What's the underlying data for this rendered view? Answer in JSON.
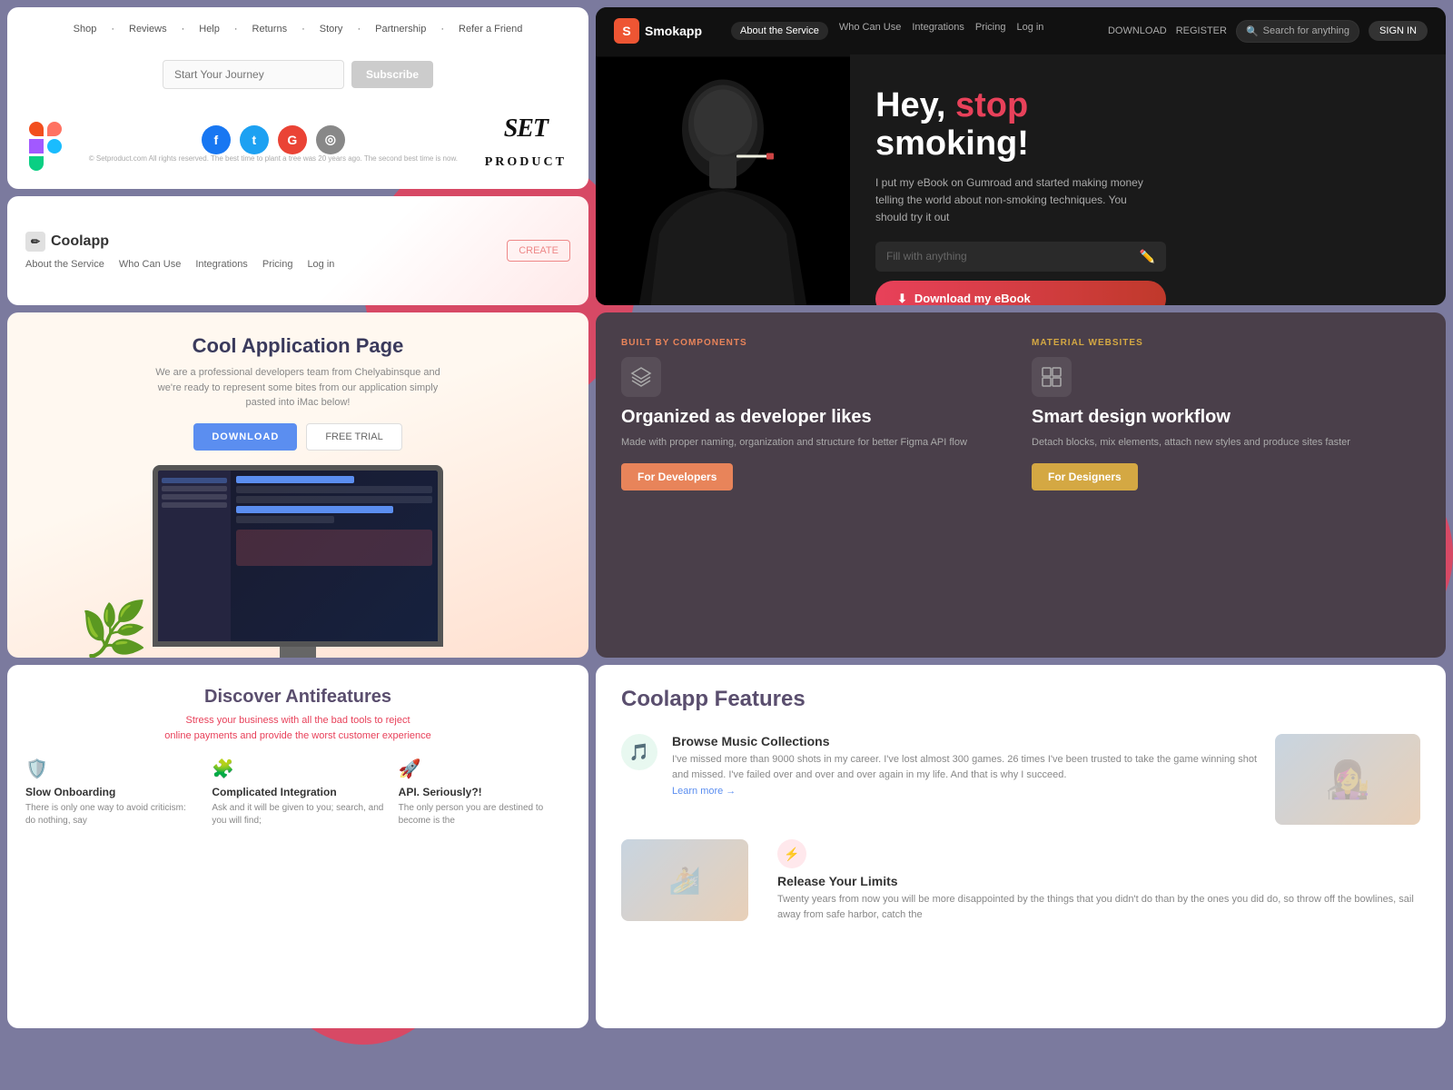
{
  "background": "#7b7a9e",
  "blobs": {
    "colors": [
      "#e8415a"
    ]
  },
  "card_setproduct": {
    "nav": [
      "Shop",
      "Reviews",
      "Help",
      "Returns",
      "Story",
      "Partnership",
      "Refer a Friend"
    ],
    "newsletter_placeholder": "Start Your Journey",
    "subscribe_label": "Subscribe",
    "social": [
      "f",
      "t",
      "g+",
      "ig"
    ],
    "logo_text": "SET",
    "logo_sub": "PRODUCT",
    "footer": "© Setproduct.com All rights reserved. The best time to plant a tree was 20 years ago. The second best time is now."
  },
  "card_smokapp": {
    "logo": "Smokapp",
    "logo_initial": "S",
    "nav_links": [
      "About the Service",
      "Who Can Use",
      "Integrations",
      "Pricing",
      "Log in"
    ],
    "nav_actions": [
      "DOWNLOAD",
      "REGISTER",
      "SIGN IN"
    ],
    "search_placeholder": "Search for anything",
    "heading_part1": "Hey, ",
    "heading_highlight": "stop",
    "heading_part2": " smoking!",
    "description": "I put my eBook on Gumroad and started making money telling the world about non-smoking techniques. You should try it out",
    "input_placeholder": "Fill with anything",
    "download_btn": "Download my eBook"
  },
  "card_coolapp_small": {
    "logo": "Coolapp",
    "nav_links": [
      "About the Service",
      "Who Can Use",
      "Integrations",
      "Pricing",
      "Log in"
    ],
    "create_btn": "CREATE"
  },
  "card_coolapp_main": {
    "title": "Cool Application Page",
    "subtitle": "We are a professional developers team from Chelyabinsque and we're ready to represent some bites from our application simply pasted into iMac below!",
    "download_btn": "DOWNLOAD",
    "trial_btn": "FREE TRIAL"
  },
  "card_components": {
    "left": {
      "tag": "BUILT BY COMPONENTS",
      "heading": "Organized as developer likes",
      "description": "Made with proper naming, organization and structure for better Figma API flow",
      "btn_label": "For Developers"
    },
    "right": {
      "tag": "MATERIAL WEBSITES",
      "heading": "Smart design workflow",
      "description": "Detach blocks, mix elements, attach new styles and produce sites faster",
      "btn_label": "For Designers"
    }
  },
  "card_features": {
    "title": "Coolapp Features",
    "features": [
      {
        "name": "Browse Music Collections",
        "desc": "I've missed more than 9000 shots in my career. I've lost almost 300 games. 26 times I've been trusted to take the game winning shot and missed. I've failed over and over and over again in my life. And that is why I succeed.",
        "learn": "Learn more →"
      },
      {
        "name": "Release Your Limits",
        "desc": "Twenty years from now you will be more disappointed by the things that you didn't do than by the ones you did do, so throw off the bowlines, sail away from safe harbor, catch the",
        "learn": ""
      }
    ]
  },
  "card_antifeatures": {
    "title": "Discover Antifeatures",
    "subtitle": "Stress your business with all the bad tools to reject\nonline payments and provide the worst customer experience",
    "features": [
      {
        "name": "Slow Onboarding",
        "desc": "There is only one way to avoid criticism: do nothing, say"
      },
      {
        "name": "Complicated Integration",
        "desc": "Ask and it will be given to you; search, and you will find;"
      },
      {
        "name": "API. Seriously?!",
        "desc": "The only person you are destined to become is the"
      }
    ]
  }
}
